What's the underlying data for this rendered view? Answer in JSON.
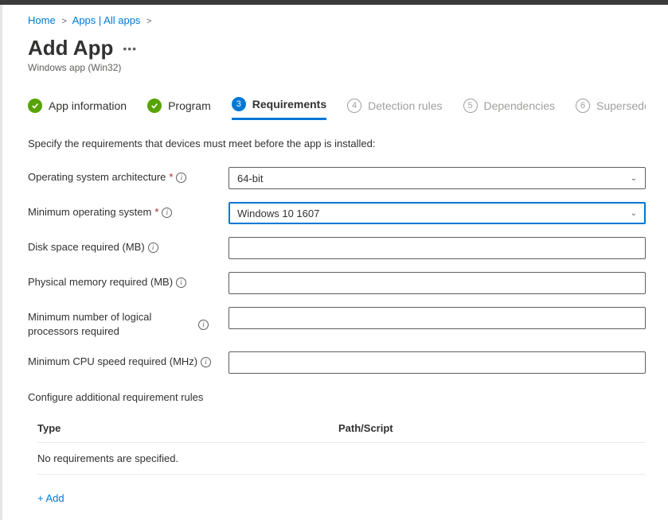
{
  "breadcrumb": {
    "home": "Home",
    "apps_list": "Apps | All apps"
  },
  "header": {
    "title": "Add App",
    "subtitle": "Windows app (Win32)"
  },
  "tabs": {
    "t1": "App information",
    "t2": "Program",
    "t3": "Requirements",
    "t4": "Detection rules",
    "t5": "Dependencies",
    "t6": "Supersedence",
    "n4": "4",
    "n5": "5",
    "n6": "6",
    "n3": "3"
  },
  "form": {
    "description": "Specify the requirements that devices must meet before the app is installed:",
    "os_arch_label": "Operating system architecture",
    "os_arch_value": "64-bit",
    "min_os_label": "Minimum operating system",
    "min_os_value": "Windows 10 1607",
    "disk_label": "Disk space required (MB)",
    "mem_label": "Physical memory required (MB)",
    "cpu_count_label": "Minimum number of logical processors required",
    "cpu_speed_label": "Minimum CPU speed required (MHz)"
  },
  "rules": {
    "section_label": "Configure additional requirement rules",
    "col_type": "Type",
    "col_path": "Path/Script",
    "empty": "No requirements are specified.",
    "add": "+ Add"
  }
}
